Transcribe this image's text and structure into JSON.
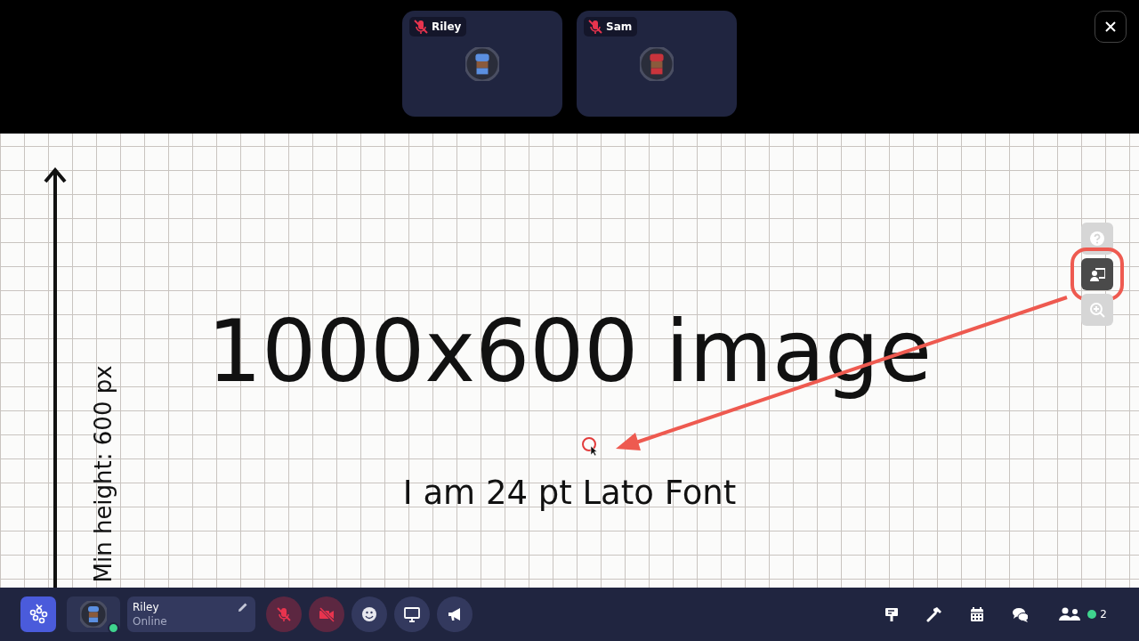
{
  "participants": [
    {
      "name": "Riley",
      "muted": true,
      "color": "#5b8fe0"
    },
    {
      "name": "Sam",
      "muted": true,
      "color": "#c9343c"
    }
  ],
  "shared_image": {
    "axis_label": "Min height: 600 px",
    "heading": "1000x600 image",
    "caption": "I am 24 pt Lato Font"
  },
  "side_tools": [
    {
      "kind": "help",
      "selected": false
    },
    {
      "kind": "present",
      "selected": true
    },
    {
      "kind": "zoom",
      "selected": false
    }
  ],
  "user": {
    "name": "Riley",
    "status": "Online",
    "online": true,
    "color": "#5b8fe0"
  },
  "controls": [
    {
      "kind": "mic",
      "off": true
    },
    {
      "kind": "camera",
      "off": true
    },
    {
      "kind": "emoji",
      "off": false
    },
    {
      "kind": "screen",
      "off": false
    },
    {
      "kind": "megaphone",
      "off": false
    }
  ],
  "tools": [
    {
      "kind": "sign"
    },
    {
      "kind": "hammer"
    },
    {
      "kind": "calendar"
    },
    {
      "kind": "chat"
    }
  ],
  "people": {
    "online": true,
    "count": "2"
  }
}
